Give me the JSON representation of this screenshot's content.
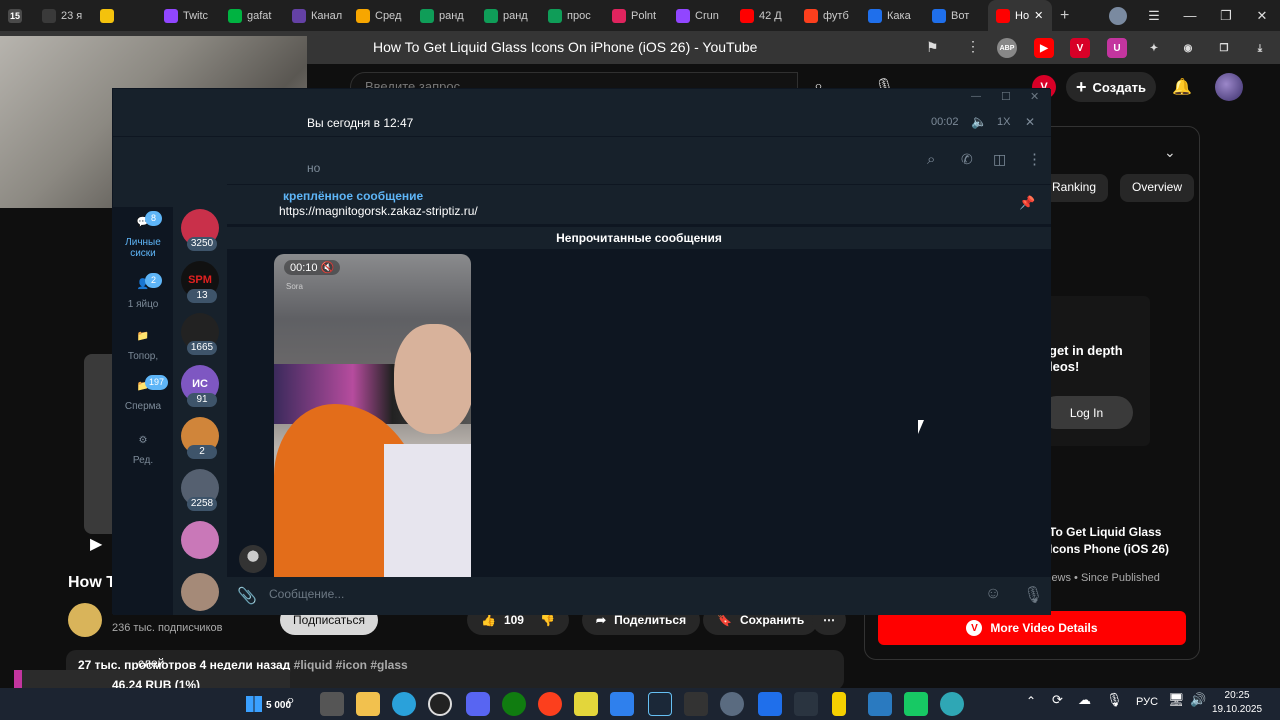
{
  "browser": {
    "tabs": [
      {
        "label": "23 я",
        "color": "#3a3a3a"
      },
      {
        "label": "",
        "color": "#f4c20d"
      },
      {
        "label": "Twitc",
        "color": "#9146ff"
      },
      {
        "label": "gafat",
        "color": "#00b341"
      },
      {
        "label": "Канал",
        "color": "#6441a5"
      },
      {
        "label": "Сред",
        "color": "#f7a600"
      },
      {
        "label": "ранд",
        "color": "#0f9d58"
      },
      {
        "label": "ранд",
        "color": "#0f9d58"
      },
      {
        "label": "прос",
        "color": "#0f9d58"
      },
      {
        "label": "Polnt",
        "color": "#e0245e"
      },
      {
        "label": "Crun",
        "color": "#9146ff"
      },
      {
        "label": "42 Д",
        "color": "#ff0000"
      },
      {
        "label": "футб",
        "color": "#fc3f1d"
      },
      {
        "label": "Кака",
        "color": "#1f6feb"
      },
      {
        "label": "Вот",
        "color": "#1f6feb"
      },
      {
        "label": "Но",
        "color": "#ff0000"
      }
    ],
    "tab_count": "15",
    "page_title": "How To Get Liquid Glass Icons On iPhone (iOS 26) - YouTube",
    "extensions": [
      "ABP",
      "",
      "V",
      "U"
    ]
  },
  "youtube": {
    "search_placeholder": "Введите запрос",
    "create_label": "Создать",
    "chips": [
      "Ranking",
      "Overview"
    ],
    "login_text": "get in depth\nleos!",
    "login_button": "Log In",
    "side_video_title": "To Get Liquid Glass Icons Phone (iOS 26)",
    "side_video_meta": "iews  •  Since Published",
    "more_details": "More Video Details",
    "main_title": "How T",
    "subscribers": "236 тыс. подписчиков",
    "subscribe": "Подписаться",
    "likes": "109",
    "share": "Поделиться",
    "save": "Сохранить",
    "views_ago": "27 тыс. просмотров  4 недели назад",
    "tags": "#liquid #icon #glass"
  },
  "telegram": {
    "player_text": "Вы сегодня в 12:47",
    "player_time": "00:02",
    "speed": "1X",
    "chat_status": "но",
    "pinned_label": "креплённое сообщение",
    "pinned_url": "https://magnitogorsk.zakaz-striptiz.ru/",
    "unread_label": "Непрочитанные сообщения",
    "video_duration": "00:10",
    "watermark": "Sora",
    "composer_placeholder": "Сообщение...",
    "folders": [
      {
        "label": "Личные\nсиски",
        "badge": "8"
      },
      {
        "label": "1 яйцо",
        "badge": "2"
      },
      {
        "label": "Топор,",
        "badge": ""
      },
      {
        "label": "Сперма",
        "badge": "197"
      },
      {
        "label": "Ред.",
        "badge": ""
      }
    ],
    "chat_counts": [
      "3250",
      "13",
      "1665",
      "91",
      "2",
      "2258",
      "",
      ""
    ],
    "chat_initials": [
      "",
      "SPM",
      "",
      "ИС",
      "",
      "",
      "",
      ""
    ]
  },
  "taskbar": {
    "ticker_label": "слей",
    "ticker_value": "46.24 RUB (1%)",
    "coins": "5 000",
    "lang": "РУС",
    "time": "20:25",
    "date": "19.10.2025"
  }
}
